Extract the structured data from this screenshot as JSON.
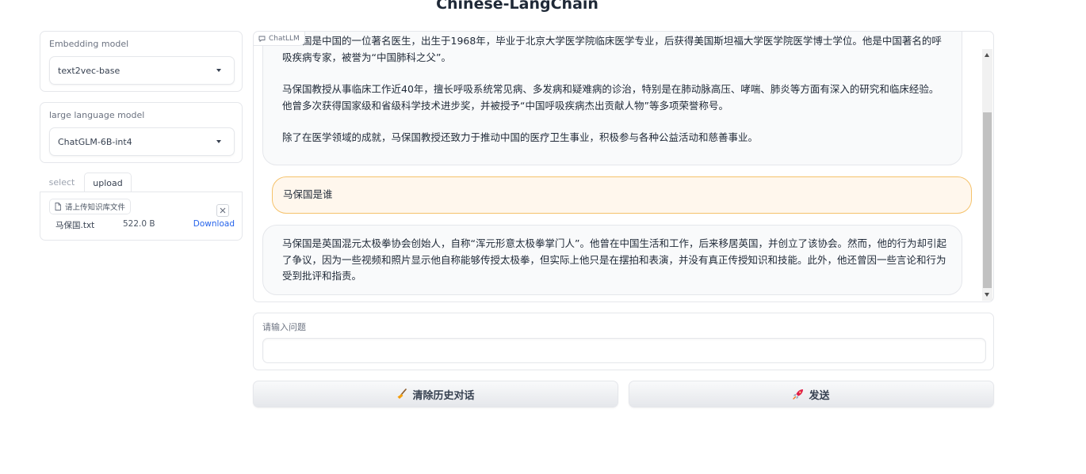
{
  "app": {
    "title": "Chinese-LangChain"
  },
  "embedding": {
    "label": "Embedding model",
    "selected": "text2vec-base"
  },
  "llm": {
    "label": "large language model",
    "selected": "ChatGLM-6B-int4"
  },
  "tabs": [
    {
      "label": "select"
    },
    {
      "label": "upload"
    }
  ],
  "upload": {
    "prompt": "请上传知识库文件",
    "file": {
      "name": "马保国.txt",
      "size": "522.0 B",
      "download_label": "Download"
    }
  },
  "chat": {
    "tag_label": "ChatLLM",
    "messages": [
      {
        "role": "bot",
        "paragraphs": [
          "马保国是中国的一位著名医生，出生于1968年，毕业于北京大学医学院临床医学专业，后获得美国斯坦福大学医学院医学博士学位。他是中国著名的呼吸疾病专家，被誉为“中国肺科之父”。",
          "马保国教授从事临床工作近40年，擅长呼吸系统常见病、多发病和疑难病的诊治，特别是在肺动脉高压、哮喘、肺炎等方面有深入的研究和临床经验。他曾多次获得国家级和省级科学技术进步奖，并被授予“中国呼吸疾病杰出贡献人物”等多项荣誉称号。",
          "除了在医学领域的成就，马保国教授还致力于推动中国的医疗卫生事业，积极参与各种公益活动和慈善事业。"
        ]
      },
      {
        "role": "user",
        "text": "马保国是谁"
      },
      {
        "role": "bot",
        "text": "马保国是英国混元太极拳协会创始人，自称“浑元形意太极拳掌门人”。他曾在中国生活和工作，后来移居英国，并创立了该协会。然而，他的行为却引起了争议，因为一些视频和照片显示他自称能够传授太极拳，但实际上他只是在摆拍和表演，并没有真正传授知识和技能。此外，他还曾因一些言论和行为受到批评和指责。"
      }
    ]
  },
  "input": {
    "label": "请输入问题",
    "value": "",
    "placeholder": ""
  },
  "buttons": {
    "clear": {
      "label": "清除历史对话",
      "icon": "broom-icon"
    },
    "send": {
      "label": "发送",
      "icon": "rocket-icon"
    }
  },
  "colors": {
    "user_bubble_border": "#f5c26b",
    "user_bubble_bg": "#fff7ed",
    "link": "#2563eb"
  }
}
